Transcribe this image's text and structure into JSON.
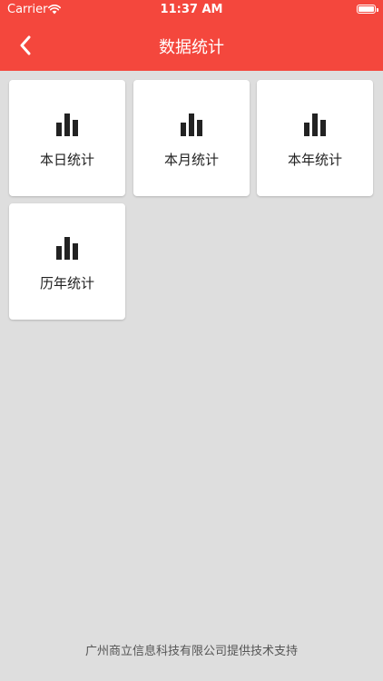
{
  "status_bar": {
    "carrier": "Carrier",
    "time": "11:37 AM",
    "wifi_icon": "wifi-icon",
    "battery_icon": "battery-icon"
  },
  "header": {
    "title": "数据统计",
    "back_icon": "chevron-left-icon",
    "background_color": "#f4473d"
  },
  "tiles": [
    {
      "label": "本日统计",
      "icon": "bar-chart-icon"
    },
    {
      "label": "本月统计",
      "icon": "bar-chart-icon"
    },
    {
      "label": "本年统计",
      "icon": "bar-chart-icon"
    },
    {
      "label": "历年统计",
      "icon": "bar-chart-icon"
    }
  ],
  "footer": {
    "text": "广州商立信息科技有限公司提供技术支持"
  },
  "colors": {
    "accent": "#f4473d",
    "page_background": "#dedede",
    "tile_background": "#ffffff",
    "icon_color": "#222222"
  }
}
